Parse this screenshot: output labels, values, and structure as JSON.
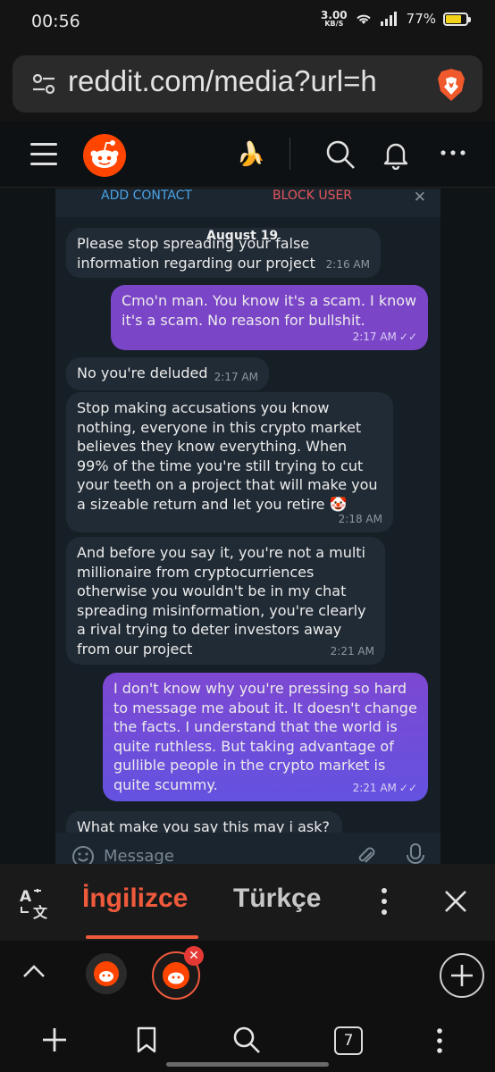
{
  "status_bar": {
    "time": "00:56",
    "net_speed": "3.00",
    "net_unit": "KB/S",
    "battery_percent": "77%",
    "battery_level": 0.77,
    "battery_color": "#f2d21b"
  },
  "browser": {
    "url": "reddit.com/media?url=h",
    "tab_count": "7"
  },
  "reddit_header": {
    "icons": [
      "menu-icon",
      "reddit-logo",
      "banana-icon",
      "search-icon",
      "bell-icon",
      "more-icon"
    ]
  },
  "chat": {
    "add_contact": "ADD CONTACT",
    "block_user": "BLOCK USER",
    "close": "✕",
    "date": "August 19",
    "input_placeholder": "Message",
    "messages": [
      {
        "dir": "in",
        "text": "Please stop spreading your false information regarding our project",
        "time": "2:16 AM"
      },
      {
        "dir": "out",
        "text": "Cmo'n man. You know it's a scam. I know it's a scam. No reason for bullshit.",
        "time": "2:17 AM",
        "checks": "✓✓"
      },
      {
        "dir": "in",
        "text": "No you're deluded",
        "time": "2:17 AM"
      },
      {
        "dir": "in",
        "text": "Stop making accusations you know nothing, everyone in this crypto market believes they know everything. When 99% of the time you're still trying to cut your teeth on a project that will make you a sizeable return and let you retire 🤡",
        "time": "2:18 AM"
      },
      {
        "dir": "in",
        "text": "And before you say it, you're not a multi millionaire from cryptocurriences otherwise you wouldn't be in my chat spreading misinformation, you're clearly a rival trying to deter investors away from our project",
        "time": "2:21 AM"
      },
      {
        "dir": "out",
        "text": "I don't know why you're pressing so hard to message me about it. It doesn't change the facts. I understand that the world is quite ruthless. But taking advantage of gullible people in the crypto market is quite scummy.",
        "time": "2:21 AM",
        "checks": "✓✓"
      },
      {
        "dir": "in",
        "text": "What make you say this may i ask?",
        "time": ""
      }
    ]
  },
  "translate_bar": {
    "source_lang": "İngilizce",
    "target_lang": "Türkçe",
    "accent_color": "#f05a3c"
  }
}
